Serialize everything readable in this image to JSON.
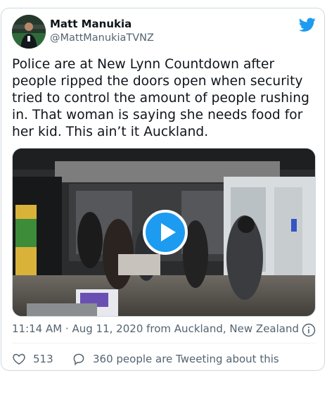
{
  "author": {
    "name": "Matt Manukia",
    "handle": "@MattManukiaTVNZ"
  },
  "tweet": {
    "text": "Police are at New Lynn Countdown after people ripped the doors open when security tried to control the amount of people rushing in. That woman is saying she needs food for her kid. This ain’t it Auckland."
  },
  "media": {
    "icon": "play-icon"
  },
  "meta": {
    "timestamp": "11:14 AM · Aug 11, 2020 from Auckland, New Zealand"
  },
  "actions": {
    "like_count": "513",
    "conversation_label": "360 people are Tweeting about this"
  },
  "colors": {
    "brand": "#1d9bf0",
    "text": "#0f1419",
    "secondary": "#536471",
    "border": "#cfd9de"
  }
}
